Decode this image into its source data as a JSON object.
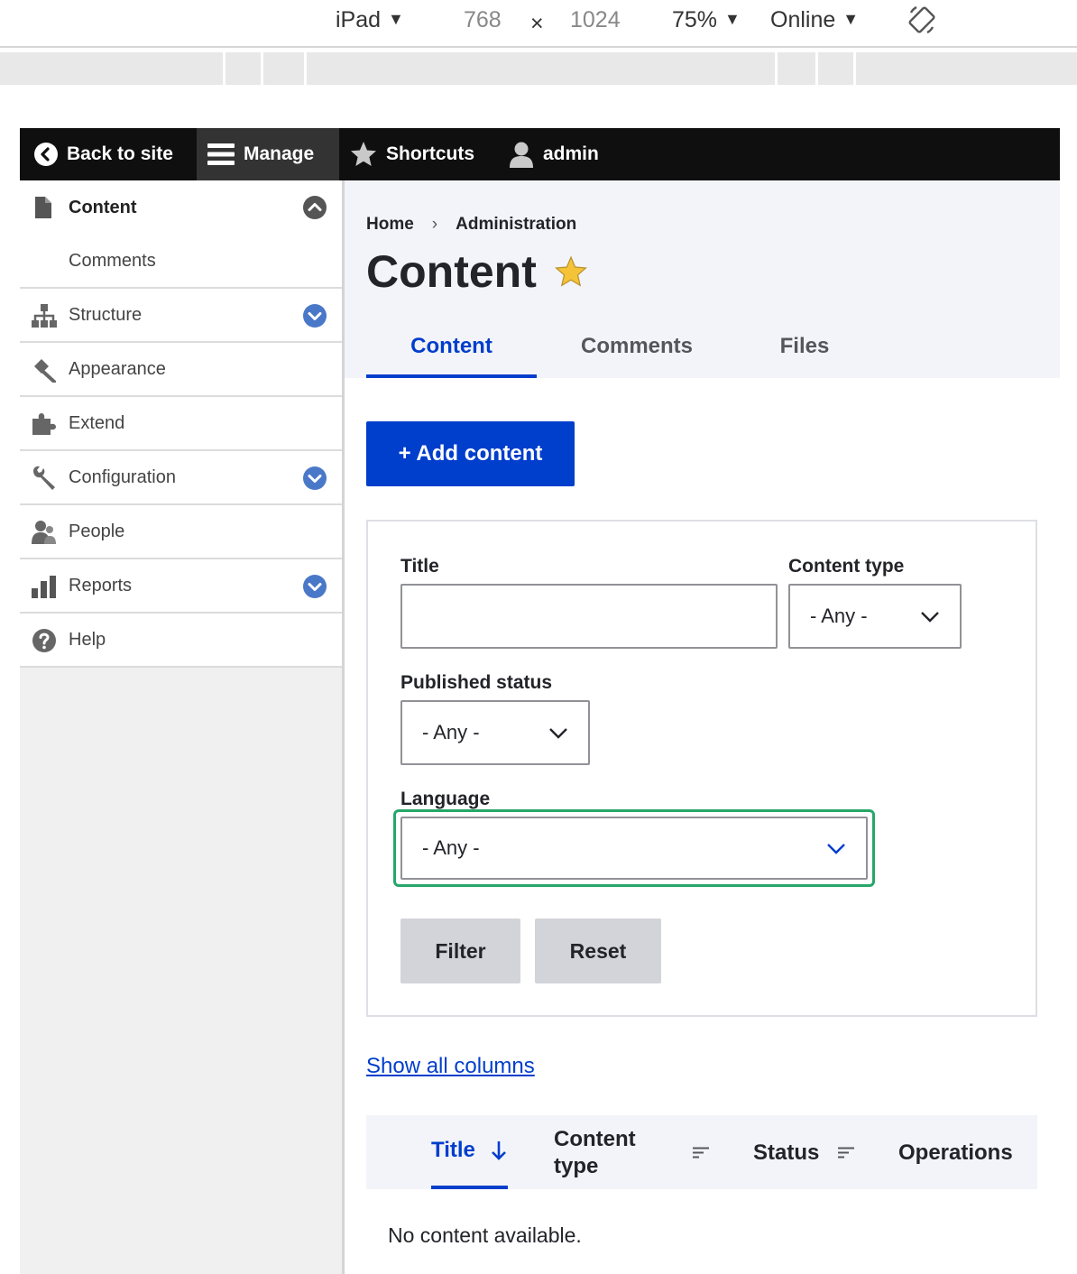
{
  "devtools": {
    "device": "iPad",
    "width": "768",
    "times": "×",
    "height": "1024",
    "zoom": "75%",
    "network": "Online",
    "caret": "▼"
  },
  "toolbar": {
    "back_to_site": "Back to site",
    "manage": "Manage",
    "shortcuts": "Shortcuts",
    "user": "admin"
  },
  "sidebar": {
    "items": [
      {
        "label": "Content",
        "icon": "content-icon",
        "toggle": "collapse"
      },
      {
        "label": "Comments"
      },
      {
        "label": "Structure",
        "icon": "structure-icon",
        "toggle": "expand"
      },
      {
        "label": "Appearance",
        "icon": "appearance-icon"
      },
      {
        "label": "Extend",
        "icon": "extend-icon"
      },
      {
        "label": "Configuration",
        "icon": "configuration-icon",
        "toggle": "expand"
      },
      {
        "label": "People",
        "icon": "people-icon"
      },
      {
        "label": "Reports",
        "icon": "reports-icon",
        "toggle": "expand"
      },
      {
        "label": "Help",
        "icon": "help-icon"
      }
    ]
  },
  "breadcrumb": {
    "home": "Home",
    "separator": "›",
    "admin": "Administration"
  },
  "page": {
    "title": "Content"
  },
  "tabs": [
    {
      "label": "Content",
      "active": true
    },
    {
      "label": "Comments",
      "active": false
    },
    {
      "label": "Files",
      "active": false
    }
  ],
  "actions": {
    "add_content": "+ Add content"
  },
  "filters": {
    "title_label": "Title",
    "title_value": "",
    "content_type_label": "Content type",
    "content_type_value": "- Any -",
    "published_label": "Published status",
    "published_value": "- Any -",
    "language_label": "Language",
    "language_value": "- Any -",
    "filter_button": "Filter",
    "reset_button": "Reset"
  },
  "show_all_columns": "Show all columns",
  "table": {
    "columns": [
      {
        "label": "Title",
        "sorted": true
      },
      {
        "label": "Content type"
      },
      {
        "label": "Status"
      },
      {
        "label": "Operations"
      }
    ],
    "empty_text": "No content available."
  },
  "colors": {
    "accent": "#003ecc",
    "focus": "#26a769",
    "toolbar": "#0f0f0f",
    "star": "#f5c338"
  }
}
